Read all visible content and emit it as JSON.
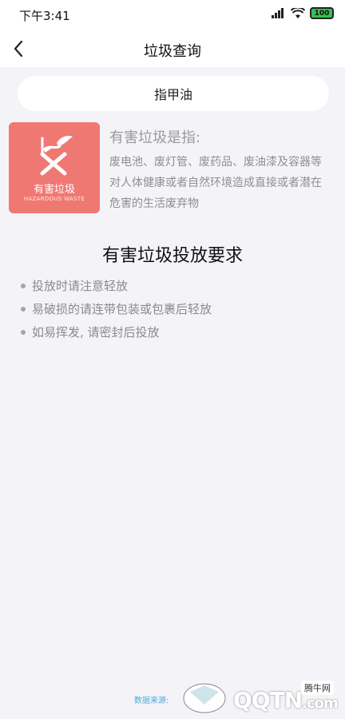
{
  "status_bar": {
    "time": "下午3:41",
    "battery": "100"
  },
  "nav": {
    "title": "垃圾查询"
  },
  "search": {
    "query": "指甲油"
  },
  "category": {
    "name": "有害垃圾",
    "english": "HAZARDOUS WASTE",
    "color": "#f07873"
  },
  "definition": {
    "title": "有害垃圾是指:",
    "text": "废电池、废灯管、废药品、废油漆及容器等对人体健康或者自然环境造成直接或者潜在危害的生活废弃物"
  },
  "requirements": {
    "title": "有害垃圾投放要求",
    "items": [
      "投放时请注意轻放",
      "易破损的请连带包装或包裹后轻放",
      "如易挥发, 请密封后投放"
    ]
  },
  "footer": {
    "data_source": "数据来源: "
  },
  "watermark": {
    "text": "QQTN",
    "suffix": ".com",
    "badge": "腾牛网"
  }
}
